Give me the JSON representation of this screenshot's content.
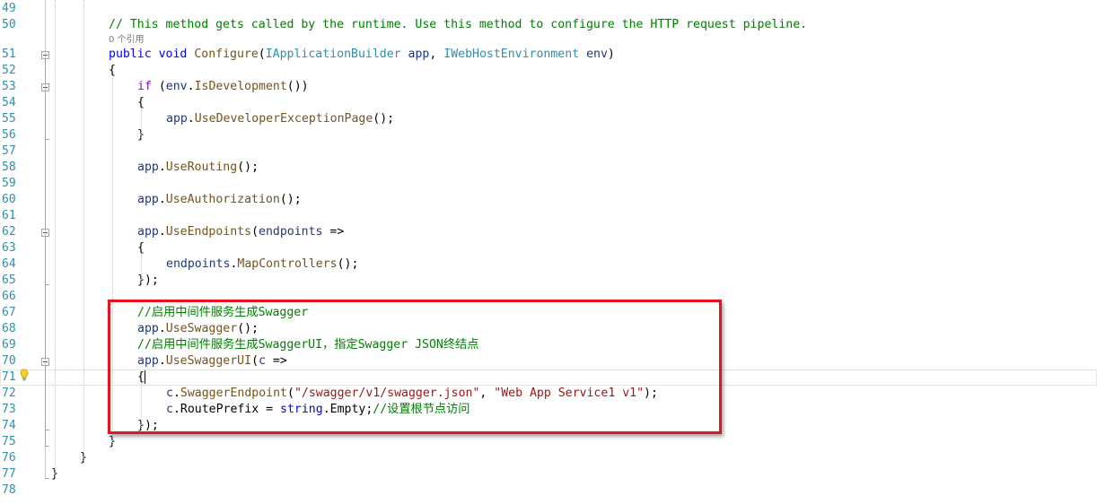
{
  "editor": {
    "codelens": "0 个引用",
    "lines": [
      {
        "num": "49",
        "indent": 0,
        "tokens": []
      },
      {
        "num": "50",
        "indent": 8,
        "tokens": [
          {
            "k": "comment",
            "t": "// This method gets called by the runtime. Use this method to configure the HTTP request pipeline."
          }
        ]
      },
      {
        "num": "51",
        "indent": 8,
        "tokens": [
          {
            "k": "keyword",
            "t": "public"
          },
          {
            "k": "punct",
            "t": " "
          },
          {
            "k": "keyword",
            "t": "void"
          },
          {
            "k": "punct",
            "t": " "
          },
          {
            "k": "method",
            "t": "Configure"
          },
          {
            "k": "punct",
            "t": "("
          },
          {
            "k": "type",
            "t": "IApplicationBuilder"
          },
          {
            "k": "punct",
            "t": " "
          },
          {
            "k": "param",
            "t": "app"
          },
          {
            "k": "punct",
            "t": ", "
          },
          {
            "k": "type",
            "t": "IWebHostEnvironment"
          },
          {
            "k": "punct",
            "t": " "
          },
          {
            "k": "param",
            "t": "env"
          },
          {
            "k": "punct",
            "t": ")"
          }
        ]
      },
      {
        "num": "52",
        "indent": 8,
        "tokens": [
          {
            "k": "punct",
            "t": "{"
          }
        ]
      },
      {
        "num": "53",
        "indent": 12,
        "tokens": [
          {
            "k": "control",
            "t": "if"
          },
          {
            "k": "punct",
            "t": " ("
          },
          {
            "k": "param",
            "t": "env"
          },
          {
            "k": "punct",
            "t": "."
          },
          {
            "k": "method",
            "t": "IsDevelopment"
          },
          {
            "k": "punct",
            "t": "())"
          }
        ]
      },
      {
        "num": "54",
        "indent": 12,
        "tokens": [
          {
            "k": "punct",
            "t": "{"
          }
        ]
      },
      {
        "num": "55",
        "indent": 16,
        "tokens": [
          {
            "k": "param",
            "t": "app"
          },
          {
            "k": "punct",
            "t": "."
          },
          {
            "k": "method",
            "t": "UseDeveloperExceptionPage"
          },
          {
            "k": "punct",
            "t": "();"
          }
        ]
      },
      {
        "num": "56",
        "indent": 12,
        "tokens": [
          {
            "k": "punct",
            "t": "}"
          }
        ]
      },
      {
        "num": "57",
        "indent": 0,
        "tokens": []
      },
      {
        "num": "58",
        "indent": 12,
        "tokens": [
          {
            "k": "param",
            "t": "app"
          },
          {
            "k": "punct",
            "t": "."
          },
          {
            "k": "method",
            "t": "UseRouting"
          },
          {
            "k": "punct",
            "t": "();"
          }
        ]
      },
      {
        "num": "59",
        "indent": 0,
        "tokens": []
      },
      {
        "num": "60",
        "indent": 12,
        "tokens": [
          {
            "k": "param",
            "t": "app"
          },
          {
            "k": "punct",
            "t": "."
          },
          {
            "k": "method",
            "t": "UseAuthorization"
          },
          {
            "k": "punct",
            "t": "();"
          }
        ]
      },
      {
        "num": "61",
        "indent": 0,
        "tokens": []
      },
      {
        "num": "62",
        "indent": 12,
        "tokens": [
          {
            "k": "param",
            "t": "app"
          },
          {
            "k": "punct",
            "t": "."
          },
          {
            "k": "method",
            "t": "UseEndpoints"
          },
          {
            "k": "punct",
            "t": "("
          },
          {
            "k": "param",
            "t": "endpoints"
          },
          {
            "k": "punct",
            "t": " =>"
          }
        ]
      },
      {
        "num": "63",
        "indent": 12,
        "tokens": [
          {
            "k": "punct",
            "t": "{"
          }
        ]
      },
      {
        "num": "64",
        "indent": 16,
        "tokens": [
          {
            "k": "param",
            "t": "endpoints"
          },
          {
            "k": "punct",
            "t": "."
          },
          {
            "k": "method",
            "t": "MapControllers"
          },
          {
            "k": "punct",
            "t": "();"
          }
        ]
      },
      {
        "num": "65",
        "indent": 12,
        "tokens": [
          {
            "k": "punct",
            "t": "});"
          }
        ]
      },
      {
        "num": "66",
        "indent": 0,
        "tokens": []
      },
      {
        "num": "67",
        "indent": 12,
        "tokens": [
          {
            "k": "comment",
            "t": "//启用中间件服务生成Swagger"
          }
        ]
      },
      {
        "num": "68",
        "indent": 12,
        "tokens": [
          {
            "k": "param",
            "t": "app"
          },
          {
            "k": "punct",
            "t": "."
          },
          {
            "k": "method",
            "t": "UseSwagger"
          },
          {
            "k": "punct",
            "t": "();"
          }
        ]
      },
      {
        "num": "69",
        "indent": 12,
        "tokens": [
          {
            "k": "comment",
            "t": "//启用中间件服务生成SwaggerUI，指定Swagger JSON终结点"
          }
        ]
      },
      {
        "num": "70",
        "indent": 12,
        "tokens": [
          {
            "k": "param",
            "t": "app"
          },
          {
            "k": "punct",
            "t": "."
          },
          {
            "k": "method",
            "t": "UseSwaggerUI"
          },
          {
            "k": "punct",
            "t": "("
          },
          {
            "k": "param",
            "t": "c"
          },
          {
            "k": "punct",
            "t": " =>"
          }
        ]
      },
      {
        "num": "71",
        "indent": 12,
        "tokens": [
          {
            "k": "punct",
            "t": "{"
          }
        ]
      },
      {
        "num": "72",
        "indent": 16,
        "tokens": [
          {
            "k": "param",
            "t": "c"
          },
          {
            "k": "punct",
            "t": "."
          },
          {
            "k": "method",
            "t": "SwaggerEndpoint"
          },
          {
            "k": "punct",
            "t": "("
          },
          {
            "k": "string",
            "t": "\"/swagger/v1/swagger.json\""
          },
          {
            "k": "punct",
            "t": ", "
          },
          {
            "k": "string",
            "t": "\"Web App Service1 v1\""
          },
          {
            "k": "punct",
            "t": ");"
          }
        ]
      },
      {
        "num": "73",
        "indent": 16,
        "tokens": [
          {
            "k": "param",
            "t": "c"
          },
          {
            "k": "punct",
            "t": ".RoutePrefix = "
          },
          {
            "k": "keyword",
            "t": "string"
          },
          {
            "k": "punct",
            "t": ".Empty;"
          },
          {
            "k": "comment",
            "t": "//设置根节点访问"
          }
        ]
      },
      {
        "num": "74",
        "indent": 12,
        "tokens": [
          {
            "k": "punct",
            "t": "});"
          }
        ]
      },
      {
        "num": "75",
        "indent": 8,
        "tokens": [
          {
            "k": "punct",
            "t": "}"
          }
        ]
      },
      {
        "num": "76",
        "indent": 4,
        "tokens": [
          {
            "k": "punct",
            "t": "}"
          }
        ]
      },
      {
        "num": "77",
        "indent": 0,
        "tokens": [
          {
            "k": "punct",
            "t": "}"
          }
        ]
      },
      {
        "num": "78",
        "indent": 0,
        "tokens": []
      }
    ],
    "current_line": "71",
    "colors": {
      "keyword": "#0000ff",
      "control": "#8f08c4",
      "type": "#2b91af",
      "comment": "#008000",
      "string": "#a31515",
      "method": "#74531f",
      "param": "#1f377f",
      "line_number": "#2b91af",
      "highlight_border": "#e8141c"
    },
    "icons": {
      "gutter_hint": "lightbulb-icon",
      "fold_marker": "collapse-minus-icon"
    }
  }
}
